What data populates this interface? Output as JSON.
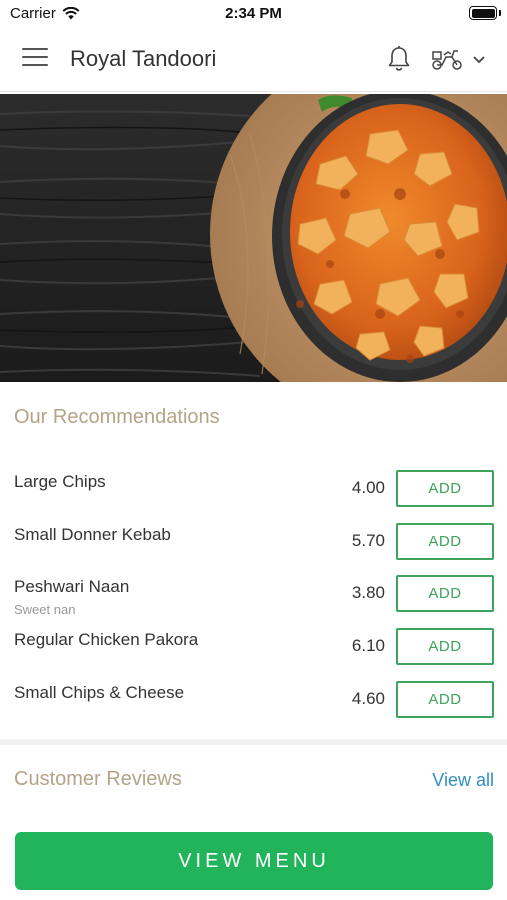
{
  "status_bar": {
    "carrier": "Carrier",
    "time": "2:34 PM"
  },
  "header": {
    "title": "Royal Tandoori",
    "icons": [
      "menu-icon",
      "bell-icon",
      "delivery-scooter-icon",
      "chevron-down-icon"
    ]
  },
  "hero": {
    "description_icon": "curry-bowl-image"
  },
  "recommendations": {
    "title": "Our Recommendations",
    "add_label": "ADD",
    "items": [
      {
        "name": "Large Chips",
        "desc": "",
        "price": "4.00"
      },
      {
        "name": "Small Donner Kebab",
        "desc": "",
        "price": "5.70"
      },
      {
        "name": "Peshwari Naan",
        "desc": "Sweet nan",
        "price": "3.80"
      },
      {
        "name": "Regular Chicken Pakora",
        "desc": "",
        "price": "6.10"
      },
      {
        "name": "Small Chips & Cheese",
        "desc": "",
        "price": "4.60"
      }
    ]
  },
  "reviews": {
    "title": "Customer Reviews",
    "view_all": "View all"
  },
  "footer": {
    "view_menu": "VIEW MENU"
  },
  "colors": {
    "accent_green": "#22b45a",
    "outline_green": "#3da35d",
    "section_title": "#b3a487",
    "link_blue": "#2f8ec4"
  }
}
